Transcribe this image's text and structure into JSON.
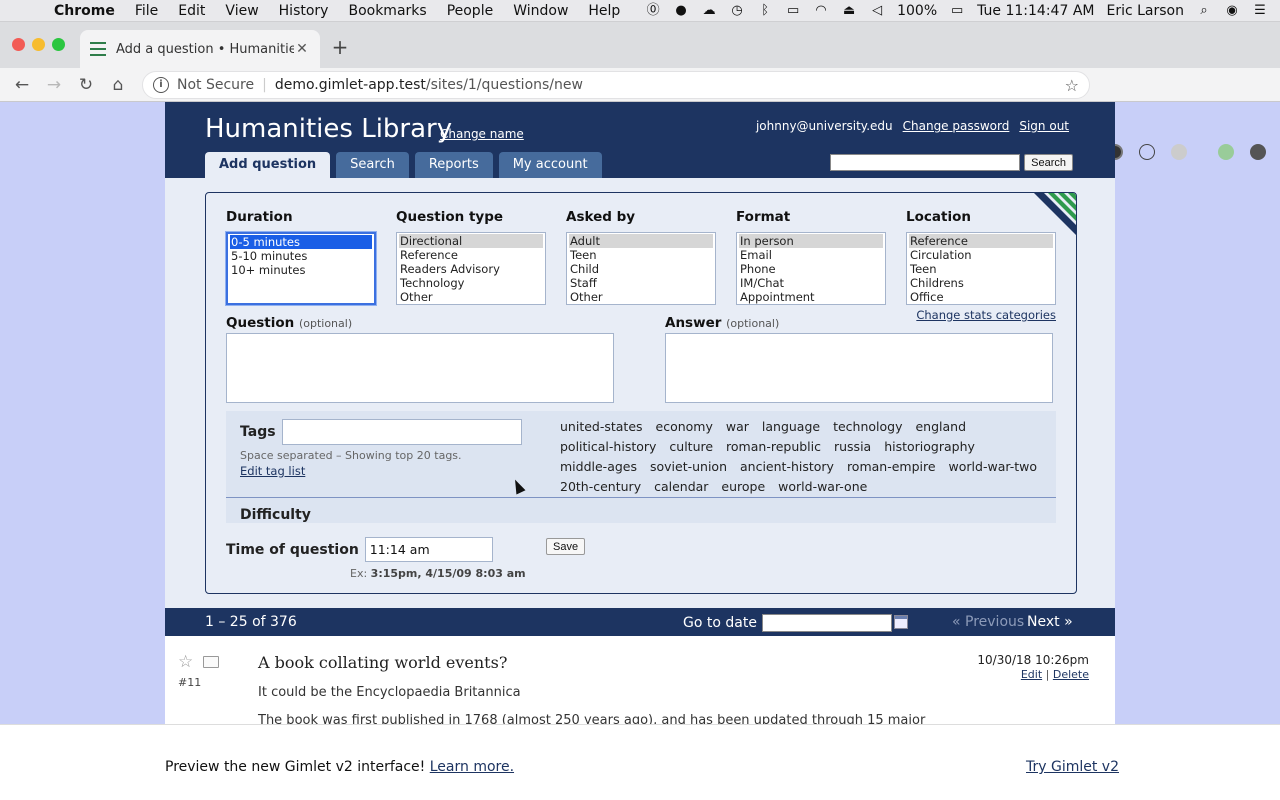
{
  "menubar": {
    "app": "Chrome",
    "items": [
      "File",
      "Edit",
      "View",
      "History",
      "Bookmarks",
      "People",
      "Window",
      "Help"
    ],
    "battery": "100%",
    "clock": "Tue 11:14:47 AM",
    "user": "Eric Larson"
  },
  "browser": {
    "tab_title": "Add a question • Humanities Library",
    "security": "Not Secure",
    "url_host": "demo.gimlet-app.test",
    "url_path": "/sites/1/questions/new"
  },
  "site": {
    "title": "Humanities Library",
    "change_name": "Change name",
    "user_email": "johnny@university.edu",
    "change_password": "Change password",
    "sign_out": "Sign out",
    "tabs": [
      "Add question",
      "Search",
      "Reports",
      "My account"
    ],
    "search_button": "Search"
  },
  "form": {
    "stats": [
      {
        "label": "Duration",
        "options": [
          "0-5 minutes",
          "5-10 minutes",
          "10+ minutes"
        ],
        "selected": "0-5 minutes"
      },
      {
        "label": "Question type",
        "options": [
          "Directional",
          "Reference",
          "Readers Advisory",
          "Technology",
          "Other"
        ],
        "selected": "Directional"
      },
      {
        "label": "Asked by",
        "options": [
          "Adult",
          "Teen",
          "Child",
          "Staff",
          "Other"
        ],
        "selected": "Adult"
      },
      {
        "label": "Format",
        "options": [
          "In person",
          "Email",
          "Phone",
          "IM/Chat",
          "Appointment"
        ],
        "selected": "In person"
      },
      {
        "label": "Location",
        "options": [
          "Reference",
          "Circulation",
          "Teen",
          "Childrens",
          "Office"
        ],
        "selected": "Reference"
      }
    ],
    "change_stats": "Change stats categories",
    "question_label": "Question",
    "answer_label": "Answer",
    "optional": "(optional)",
    "tags_label": "Tags",
    "tags_hint": "Space separated – Showing top 20 tags.",
    "edit_tags": "Edit tag list",
    "tag_cloud": [
      "united-states",
      "economy",
      "war",
      "language",
      "technology",
      "england",
      "political-history",
      "culture",
      "roman-republic",
      "russia",
      "historiography",
      "middle-ages",
      "soviet-union",
      "ancient-history",
      "roman-empire",
      "world-war-two",
      "20th-century",
      "calendar",
      "europe",
      "world-war-one"
    ],
    "difficulty_label": "Difficulty",
    "time_label": "Time of question",
    "time_value": "11:14 am",
    "save": "Save",
    "time_example_prefix": "Ex:",
    "time_example": "3:15pm, 4/15/09 8:03 am"
  },
  "results": {
    "range": "1 – 25 of 376",
    "goto_label": "Go to date",
    "previous": "« Previous",
    "next": "Next »"
  },
  "entry": {
    "id": "#11",
    "title": "A book collating world events?",
    "answer": "It could be the Encyclopaedia Britannica",
    "more": "The book was first published in 1768 (almost 250 years ago), and has been updated through 15 major",
    "date": "10/30/18 10:26pm",
    "edit": "Edit",
    "delete": "Delete"
  },
  "banner": {
    "text": "Preview the new Gimlet v2 interface!",
    "learn_more": "Learn more.",
    "try": "Try Gimlet v2"
  },
  "colors": {
    "navy": "#1d3461",
    "form_bg": "#e8edf6",
    "page_bg": "#c8cff8"
  }
}
